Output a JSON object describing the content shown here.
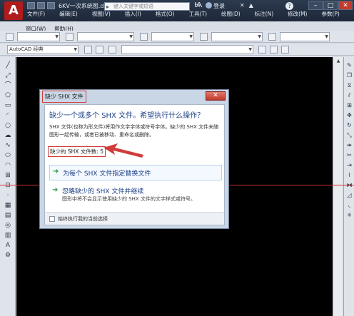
{
  "app": {
    "logo": "A",
    "doc_title": "6KV一次系统图.dwg",
    "search_placeholder": "键入关键字或短语",
    "login": "登录",
    "help": "?",
    "window_buttons": [
      "–",
      "□",
      "✕"
    ]
  },
  "menubar": {
    "row1": [
      "文件(F)",
      "编辑(E)",
      "视图(V)",
      "插入(I)",
      "格式(O)",
      "工具(T)",
      "绘图(D)",
      "标注(N)",
      "修改(M)",
      "参数(P)"
    ],
    "row2": [
      "窗口(W)",
      "帮助(H)"
    ]
  },
  "toolbar": {
    "workspace": "AutoCAD 经典"
  },
  "dialog": {
    "title": "缺少 SHX 文件",
    "close": "✕",
    "heading": "缺少一个或多个 SHX 文件。希望执行什么操作？",
    "description": "SHX 文件(也称为形文件)将用作文字字体或符号字体。缺少的 SHX 文件未随图形一起传输，或者已被移动、重命名或删除。",
    "missing_count_label": "缺少的 SHX 文件数: 5",
    "option1_label": "为每个 SHX 文件指定替换文件",
    "option2_label": "忽略缺少的 SHX 文件并继续",
    "option2_sub": "图形中将不会显示使用缺少的 SHX 文件的文字样式或符号。",
    "checkbox_label": "始终执行我的当前选择"
  },
  "colors": {
    "canvas": "#000000",
    "annotation_red": "#d13b3b",
    "option_arrow": "#2b9a3e",
    "heading_blue": "#1c3f86"
  }
}
